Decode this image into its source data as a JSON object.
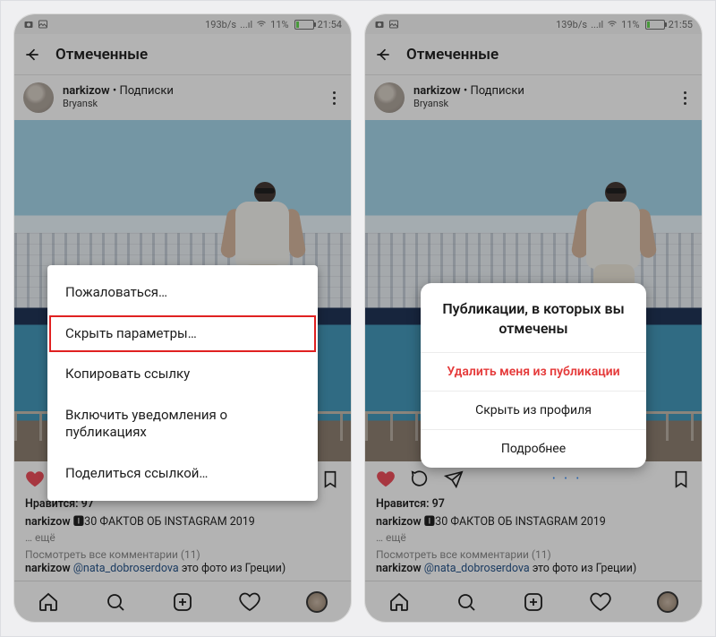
{
  "status": {
    "net_left": "193b/s",
    "net_left_2": "139b/s",
    "signal_txt": "...ıl",
    "batt_pct": "11%",
    "time": "21:54",
    "time_2": "21:55"
  },
  "header": {
    "title": "Отмеченные"
  },
  "post": {
    "username": "narkizow",
    "subscription_sep": " • ",
    "subscription": "Подписки",
    "location": "Bryansk"
  },
  "dots": "• • •",
  "likes_label": "Нравится: 97",
  "caption": {
    "username": "narkizow",
    "text": " 🅸30 ФАКТОВ ОБ INSTAGRAM 2019",
    "more": "… ещё"
  },
  "view_all": "Посмотреть все комментарии (11)",
  "comment": {
    "username": "narkizow",
    "mention": "@nata_dobroserdova",
    "text": " это фото из Греции)"
  },
  "dialog_left": {
    "items": [
      "Пожаловаться…",
      "Скрыть параметры…",
      "Копировать ссылку",
      "Включить уведомления о публикациях",
      "Поделиться ссылкой…"
    ]
  },
  "modal_right": {
    "title": "Публикации, в которых вы отмечены",
    "opt_remove": "Удалить меня из публикации",
    "opt_hide": "Скрыть из профиля",
    "opt_more": "Подробнее"
  }
}
